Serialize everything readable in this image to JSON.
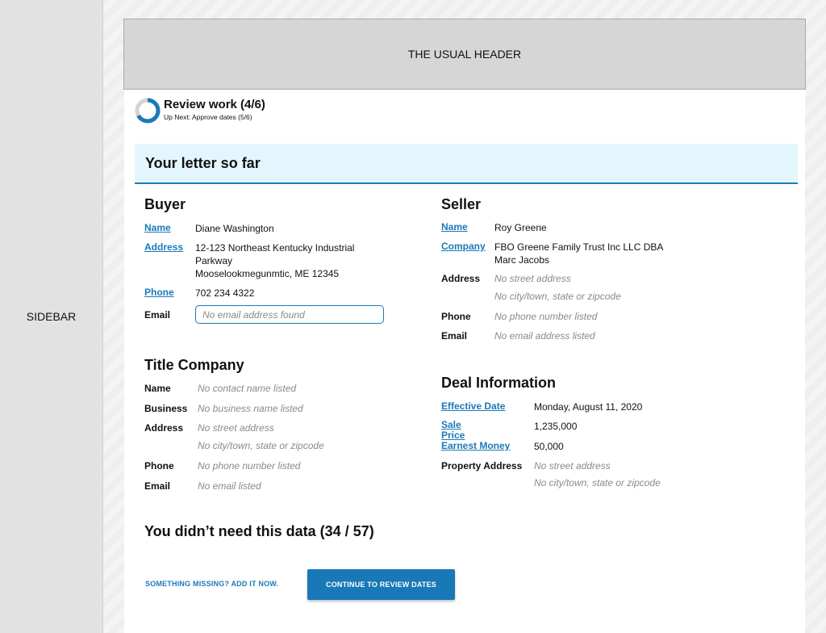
{
  "sidebar": {
    "label": "SIDEBAR"
  },
  "header": {
    "label": "THE USUAL HEADER"
  },
  "progress": {
    "title": "Review work (4/6)",
    "subtitle": "Up Next: Approve dates (5/6)",
    "fraction": 0.6667,
    "ring_color": "#1b7ab8"
  },
  "banner": {
    "title": "Your letter so far"
  },
  "buyer": {
    "title": "Buyer",
    "name_label": "Name",
    "name": "Diane Washington",
    "address_label": "Address",
    "address_line1": "12-123 Northeast Kentucky Industrial",
    "address_line2": "Parkway",
    "address_line3": "Mooselookmegunmtic, ME 12345",
    "phone_label": "Phone",
    "phone": "702 234 4322",
    "email_label": "Email",
    "email_value": "",
    "email_placeholder": "No email address found"
  },
  "title_company": {
    "title": "Title Company",
    "name_label": "Name",
    "name": "No contact name listed",
    "business_label": "Business",
    "business": "No business name listed",
    "address_label": "Address",
    "address_line1": "No street address",
    "address_line2": "No city/town, state or zipcode",
    "phone_label": "Phone",
    "phone": "No phone number listed",
    "email_label": "Email",
    "email": "No email listed"
  },
  "seller": {
    "title": "Seller",
    "name_label": "Name",
    "name": "Roy Greene",
    "company_label": "Company",
    "company_line1": "FBO Greene Family Trust Inc LLC DBA",
    "company_line2": "Marc Jacobs",
    "address_label": "Address",
    "address_line1": "No street address",
    "address_line2": "No city/town, state or zipcode",
    "phone_label": "Phone",
    "phone": "No phone number listed",
    "email_label": "Email",
    "email": "No email address listed"
  },
  "deal": {
    "title": "Deal Information",
    "effective_date_label": "Effective Date",
    "effective_date": "Monday, August 11, 2020",
    "sale_price_label_line1": "Sale",
    "sale_price_label_line2": "Price",
    "sale_price": "1,235,000",
    "earnest_money_label": "Earnest Money",
    "earnest_money": "50,000",
    "property_address_label": "Property Address",
    "property_address_line1": "No street address",
    "property_address_line2": "No city/town, state or zipcode"
  },
  "unneeded": {
    "title": "You didn’t need this data (34 / 57)"
  },
  "actions": {
    "add_label": "SOMETHING MISSING? ADD IT NOW.",
    "continue_label": "CONTINUE TO REVIEW DATES"
  },
  "colors": {
    "accent": "#1b7ab8",
    "banner_bg": "#e3f6fd",
    "muted_text": "#8a8a8a"
  }
}
